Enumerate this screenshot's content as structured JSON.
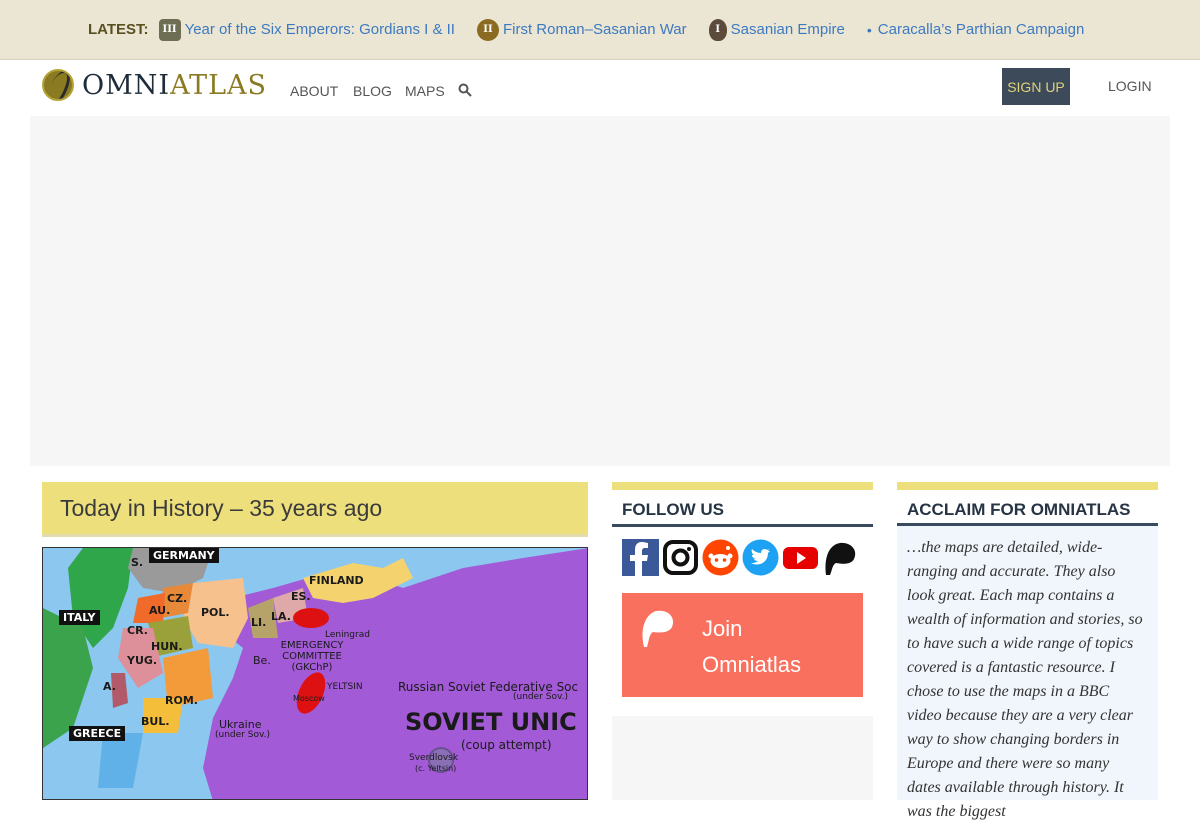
{
  "latest": {
    "label": "LATEST:",
    "items": [
      {
        "badge": "III",
        "text": "Year of the Six Emperors: Gordians I & II"
      },
      {
        "badge": "II",
        "text": "First Roman–Sasanian War"
      },
      {
        "badge": "I",
        "text": "Sasanian Empire"
      },
      {
        "badge": "•",
        "text": "Caracalla’s Parthian Campaign"
      }
    ]
  },
  "nav": {
    "logo_omni": "OMNI",
    "logo_atlas": "ATLAS",
    "links": [
      "ABOUT",
      "BLOG",
      "MAPS"
    ],
    "signup": "SIGN UP",
    "login": "LOGIN"
  },
  "today": {
    "title": "Today in History – 35 years ago",
    "map_labels": {
      "germany": "GERMANY",
      "italy": "ITALY",
      "greece": "GREECE",
      "finland": "FINLAND",
      "pol": "POL.",
      "cz": "CZ.",
      "au": "AU.",
      "hun": "HUN.",
      "yug": "YUG.",
      "rom": "ROM.",
      "bul": "BUL.",
      "li": "LI.",
      "la": "LA.",
      "es": "ES.",
      "s": "S.",
      "cr": "CR.",
      "a": "A.",
      "be": "Be.",
      "leningrad": "Leningrad",
      "emergency": "EMERGENCY COMMITTEE (GKChP)",
      "yeltsin": "YELTSIN",
      "moscow": "Moscow",
      "ukraine": "Ukraine",
      "ukraine_sub": "(under Sov.)",
      "russian_sfs": "Russian Soviet Federative Soc",
      "russian_sub": "(under Sov.)",
      "soviet": "SOVIET UNIC",
      "coup": "(coup attempt)",
      "sverdlovsk": "Sverdlovsk",
      "sverdlovsk_sub": "(c. Yeltsin)"
    }
  },
  "follow": {
    "title": "FOLLOW US",
    "icons": [
      "facebook-icon",
      "instagram-icon",
      "reddit-icon",
      "twitter-icon",
      "youtube-icon",
      "patreon-icon"
    ],
    "join_line1": "Join",
    "join_line2": "Omniatlas"
  },
  "acclaim": {
    "title": "ACCLAIM FOR OMNIATLAS",
    "text": "…the maps are detailed, wide-ranging and accurate. They also look great. Each map contains a wealth of information and stories, so to have such a wide range of topics covered is a fantastic resource. I chose to use the maps in a BBC video because they are a very clear way to show changing borders in Europe and there were so many dates available through history. It was the biggest"
  },
  "colors": {
    "accent_yellow": "#ede07c",
    "link_blue": "#3d79c1",
    "navy": "#3c4a5a",
    "join_coral": "#f9705f",
    "soviet_purple": "#a25ad6"
  }
}
